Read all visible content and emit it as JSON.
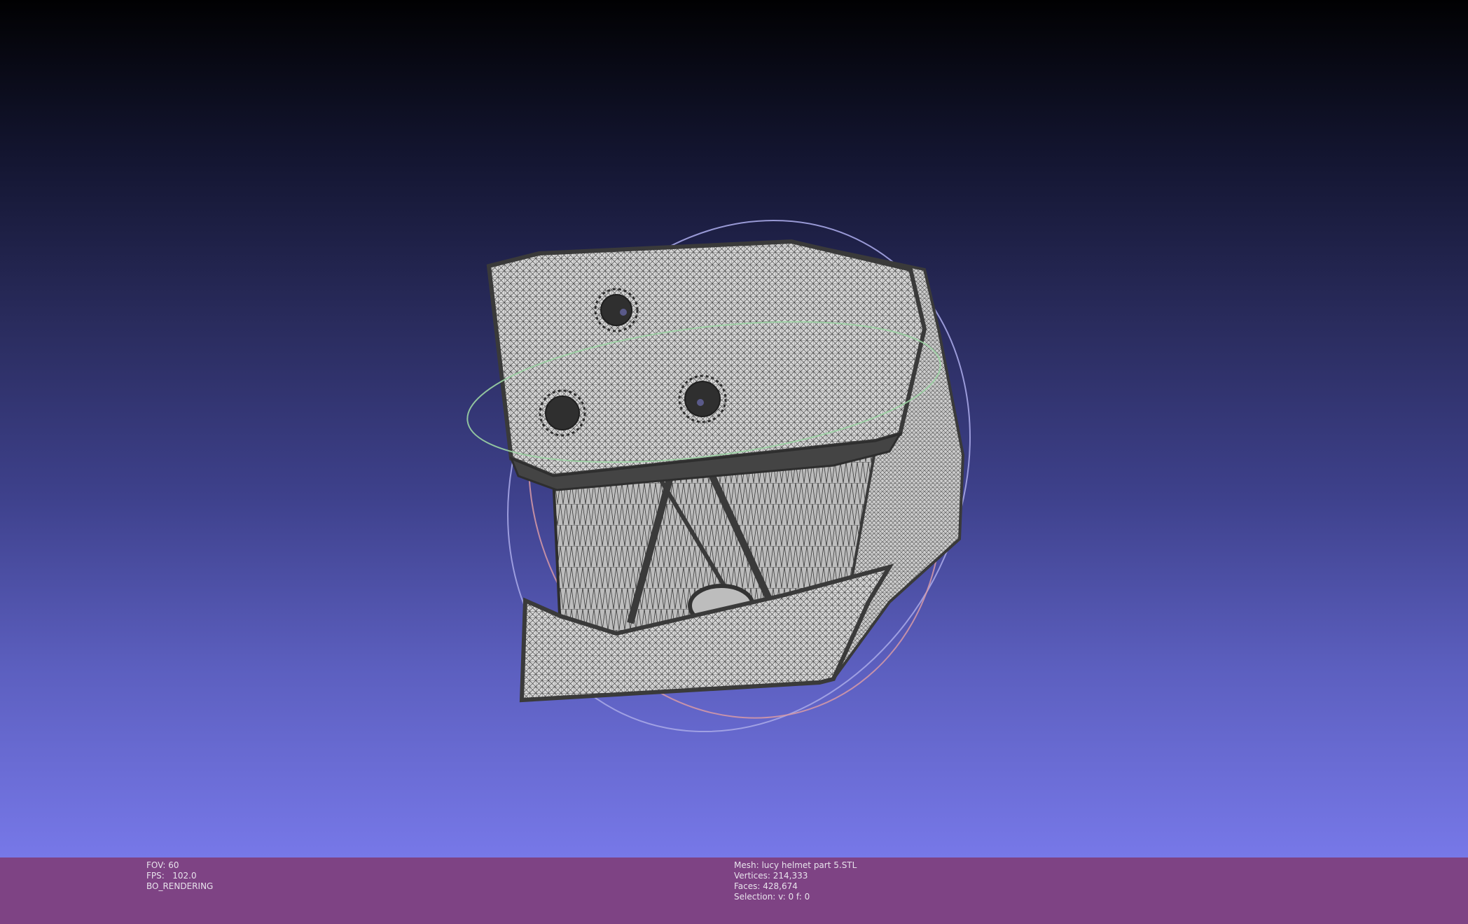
{
  "viewer": {
    "colors": {
      "background_top": "#010102",
      "background_bottom": "#7778e8",
      "mesh_fill": "#d6d6d6",
      "mesh_wire": "#3a3a3a",
      "trackball_x": "#9cd4a4",
      "trackball_y": "#d89aa6",
      "trackball_z": "#a6a6e6",
      "info_bar": "#7e4384"
    }
  },
  "info": {
    "fov_label": "FOV: 60",
    "fps_label": "FPS:   102.0",
    "render_mode": "BO_RENDERING",
    "mesh_label": "Mesh: lucy helmet part 5.STL",
    "vertices_label": "Vertices: 214,333",
    "faces_label": "Faces: 428,674",
    "selection_label": "Selection: v: 0 f: 0"
  }
}
